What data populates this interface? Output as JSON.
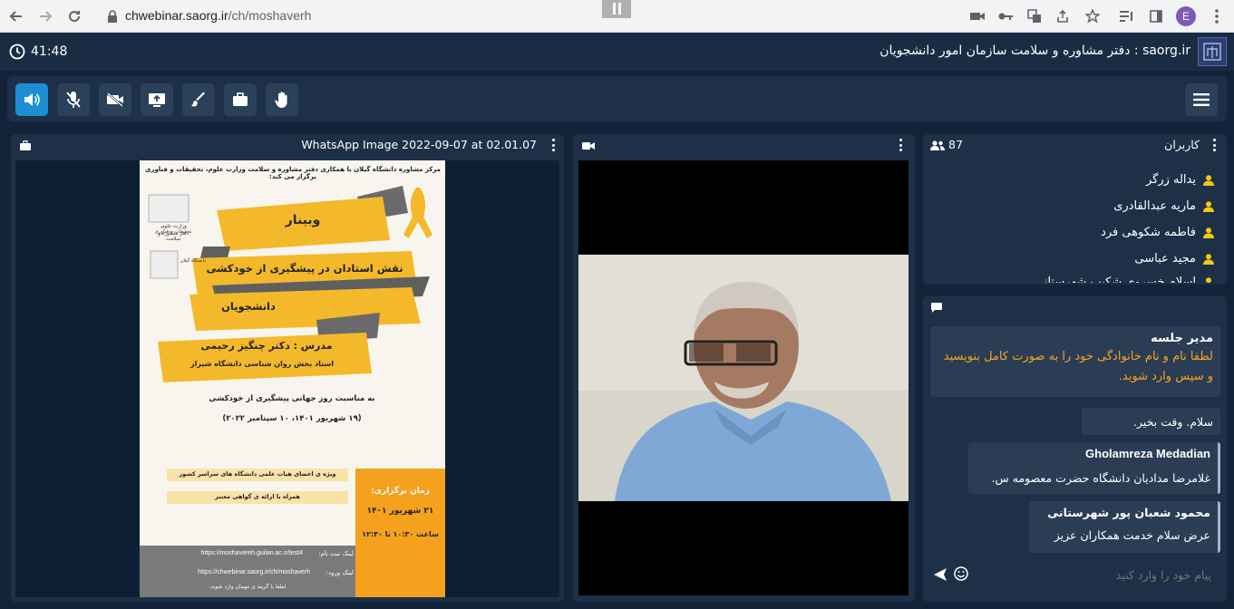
{
  "browser": {
    "url_host": "chwebinar.saorg.ir",
    "url_path": "/ch/moshaverh",
    "profile_initial": "E"
  },
  "header": {
    "timer": "41:48",
    "site_title": "saorg.ir : دفتر مشاوره و سلامت سازمان امور دانشجویان"
  },
  "presentation": {
    "title": "WhatsApp Image 2022-09-07 at 02.01.07",
    "poster": {
      "top_line": "مرکز مشاوره دانشگاه گیلان با همکاری دفتر مشاوره و سلامت وزارت علوم، تحقیقات و فناوری برگزار می کند:",
      "ministry": "وزارت علوم، تحقیقات و فناوری",
      "office": "دفتر مشاوره و سلامت",
      "uni": "دانشگاه گیلان",
      "webinar": "وبینار",
      "topic1": "نقش استادان در پیشگیری از خودکشی",
      "topic2": "دانشجویان",
      "lecturer": "مدرس : دکتر چنگیز رحیمی",
      "lecturer_role": "استاد بخش روان شناسی دانشگاه شیراز",
      "occasion": "به مناسبت روز جهانی پیشگیری از خودکشی",
      "date_line": "(۱۹ شهریور ۱۴۰۱، ۱۰ سپتامبر ۲۰۲۲)",
      "audience1": "ویژه ی اعضای هیات علمی دانشگاه های سراسر کشور",
      "audience2": "همراه با ارائه ی گواهی معتبر",
      "time_title": "زمان برگزاری:",
      "time_date": "۲۱ شهریور ۱۴۰۱",
      "time_hour": "ساعت ۱۰:۳۰ تا ۱۲:۳۰",
      "reg_label": "لینک ثبت نام:",
      "reg_url": "https://moshavereh.guilan.ac.ir/test4",
      "enter_label": "لینک ورود:",
      "enter_url": "https://chwebinar.saorg.ir/ch/moshaverh",
      "guest_note": "لطفا با گزینه ی مهمان وارد شوید."
    }
  },
  "users": {
    "title": "کاربران",
    "count": "87",
    "list": [
      "یداله زرگر",
      "ماریه عبدالقادری",
      "فاطمه شکوهی فرد",
      "مجید عباسی",
      "اسلام خسروی شکیب شهرستانی"
    ]
  },
  "chat": {
    "messages": [
      {
        "sender": "مدیر جلسه",
        "text": "لطفا نام و نام خانوادگی خود را به صورت کامل بنویسید و سپس وارد شوید."
      },
      {
        "sender": "",
        "text": "سلام. وقت بخیر."
      },
      {
        "sender": "Gholamreza Medadian",
        "text": "غلامرضا مدادیان دانشگاه حضرت معصومه س."
      },
      {
        "sender": "محمود شعبان پور شهرستانی",
        "text": "عرض سلام خدمت همکاران عزیز"
      }
    ],
    "input_placeholder": "پیام خود را وارد کنید"
  },
  "colors": {
    "accent": "#1c8fd4",
    "panel": "#1d3048",
    "background": "#12233a",
    "user_icon": "#f2c811",
    "moderator_text": "#f7a51d",
    "poster_yellow": "#f4b92a"
  }
}
